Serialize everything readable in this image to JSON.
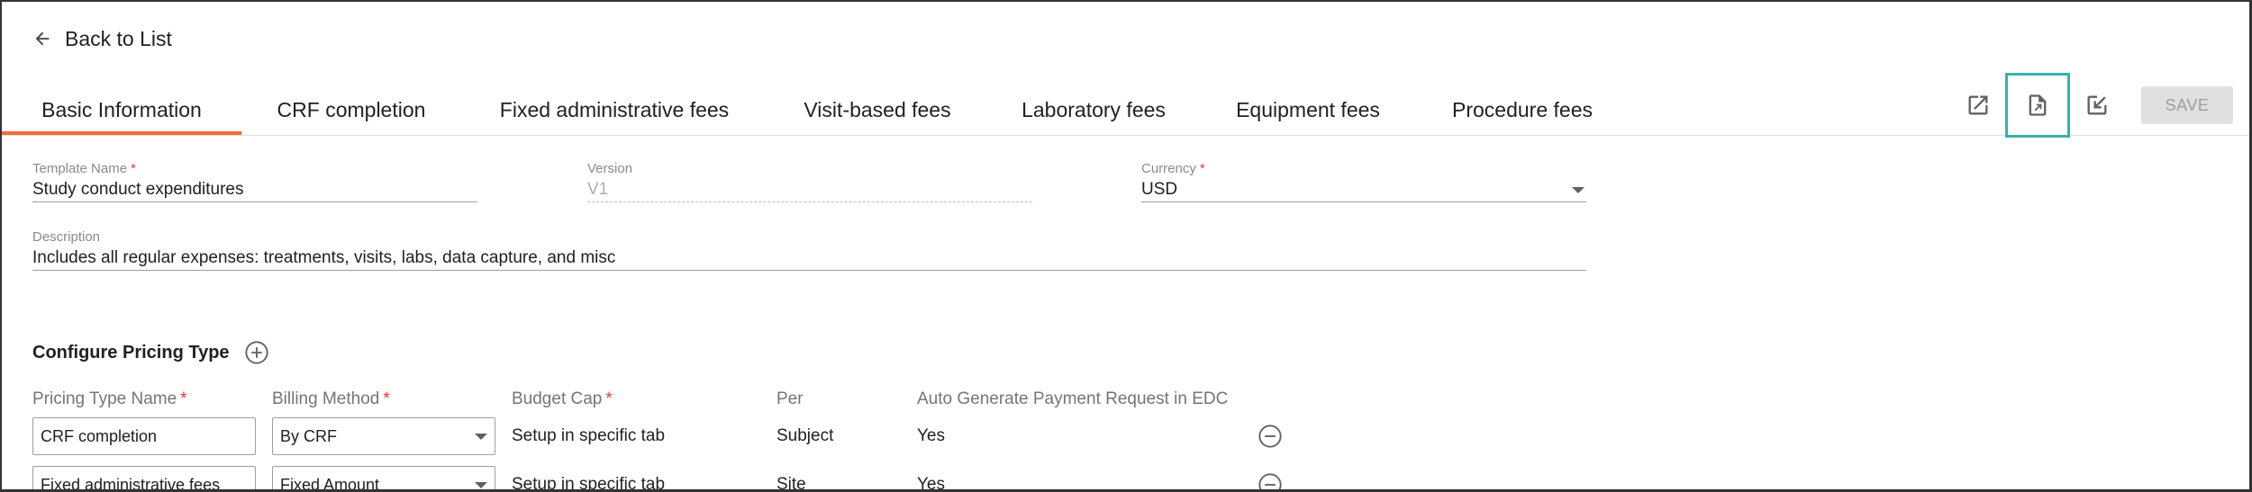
{
  "back": {
    "label": "Back to List"
  },
  "tabs": [
    {
      "label": "Basic Information"
    },
    {
      "label": "CRF completion"
    },
    {
      "label": "Fixed administrative fees"
    },
    {
      "label": "Visit-based fees"
    },
    {
      "label": "Laboratory fees"
    },
    {
      "label": "Equipment fees"
    },
    {
      "label": "Procedure fees"
    }
  ],
  "toolbar": {
    "open_icon": "open-in-new-icon",
    "export_icon": "file-export-icon",
    "import_icon": "file-import-icon",
    "save_label": "SAVE"
  },
  "form": {
    "template_name": {
      "label": "Template Name",
      "req": "*",
      "value": "Study conduct expenditures"
    },
    "version": {
      "label": "Version",
      "value": "V1"
    },
    "currency": {
      "label": "Currency",
      "req": "*",
      "value": "USD"
    },
    "description": {
      "label": "Description",
      "value": "Includes all regular expenses: treatments, visits, labs, data capture, and misc"
    }
  },
  "pricing": {
    "title": "Configure Pricing Type",
    "headers": {
      "name": "Pricing Type Name",
      "billing": "Billing Method",
      "cap": "Budget Cap",
      "per": "Per",
      "auto": "Auto Generate Payment Request in EDC",
      "req": "*"
    },
    "rows": [
      {
        "name": "CRF completion",
        "billing": "By CRF",
        "cap": "Setup in specific tab",
        "per": "Subject",
        "auto": "Yes"
      },
      {
        "name": "Fixed administrative fees",
        "billing": "Fixed Amount",
        "cap": "Setup in specific tab",
        "per": "Site",
        "auto": "Yes"
      }
    ]
  },
  "colors": {
    "accent": "#f26b3a",
    "highlight": "#38b2a8",
    "required": "#e53935"
  }
}
